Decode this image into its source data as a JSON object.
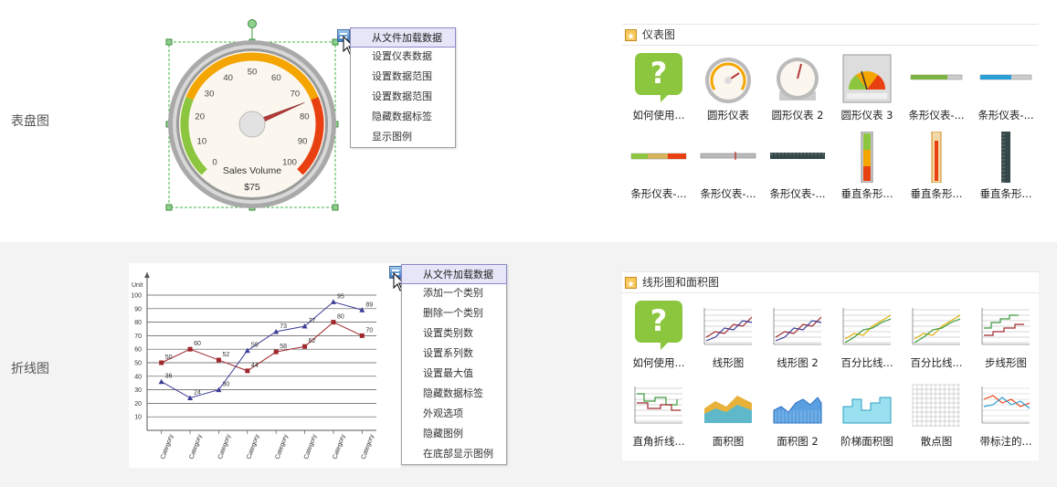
{
  "rows": {
    "gauge_label": "表盘图",
    "line_label": "折线图"
  },
  "gauge": {
    "ticks": [
      "0",
      "10",
      "20",
      "30",
      "40",
      "50",
      "60",
      "70",
      "80",
      "90",
      "100"
    ],
    "caption": "Sales Volume",
    "value_text": "$75",
    "value": 75,
    "max": 100
  },
  "gauge_menu": {
    "items": [
      "从文件加载数据",
      "设置仪表数据",
      "设置数据范围",
      "设置数据范围",
      "隐藏数据标签",
      "显示图例"
    ]
  },
  "line_menu": {
    "items": [
      "从文件加载数据",
      "添加一个类别",
      "删除一个类别",
      "设置类别数",
      "设置系列数",
      "设置最大值",
      "隐藏数据标签",
      "外观选项",
      "隐藏图例",
      "在底部显示图例"
    ]
  },
  "gauge_panel": {
    "title": "仪表图",
    "items": [
      "如何使用...",
      "圆形仪表",
      "圆形仪表 2",
      "圆形仪表 3",
      "条形仪表-...",
      "条形仪表-...",
      "条形仪表-...",
      "条形仪表-...",
      "条形仪表-...",
      "垂直条形...",
      "垂直条形...",
      "垂直条形..."
    ]
  },
  "line_panel": {
    "title": "线形图和面积图",
    "items": [
      "如何使用...",
      "线形图",
      "线形图 2",
      "百分比线...",
      "百分比线...",
      "步线形图",
      "直角折线...",
      "面积图",
      "面积图 2",
      "阶梯面积图",
      "散点图",
      "带标注的..."
    ]
  },
  "colors": {
    "accent_blue": "#3b78bd",
    "highlight": "#e6e6f8",
    "series_red": "#a0282d",
    "series_blue": "#3c3c96",
    "green": "#8cc63e"
  },
  "chart_data": {
    "type": "line",
    "ylabel": "Unit",
    "ylim": [
      0,
      100
    ],
    "yticks": [
      "10",
      "20",
      "30",
      "40",
      "50",
      "60",
      "70",
      "80",
      "90",
      "100"
    ],
    "categories": [
      "Category",
      "Category",
      "Category",
      "Category",
      "Category",
      "Category",
      "Category",
      "Category"
    ],
    "series": [
      {
        "name": "",
        "color": "#a0282d",
        "values": [
          50,
          60,
          52,
          44,
          58,
          62,
          80,
          70
        ]
      },
      {
        "name": "",
        "color": "#3c3c96",
        "values": [
          36,
          24,
          30,
          59,
          73,
          77,
          95,
          89
        ]
      }
    ],
    "grid": true
  }
}
